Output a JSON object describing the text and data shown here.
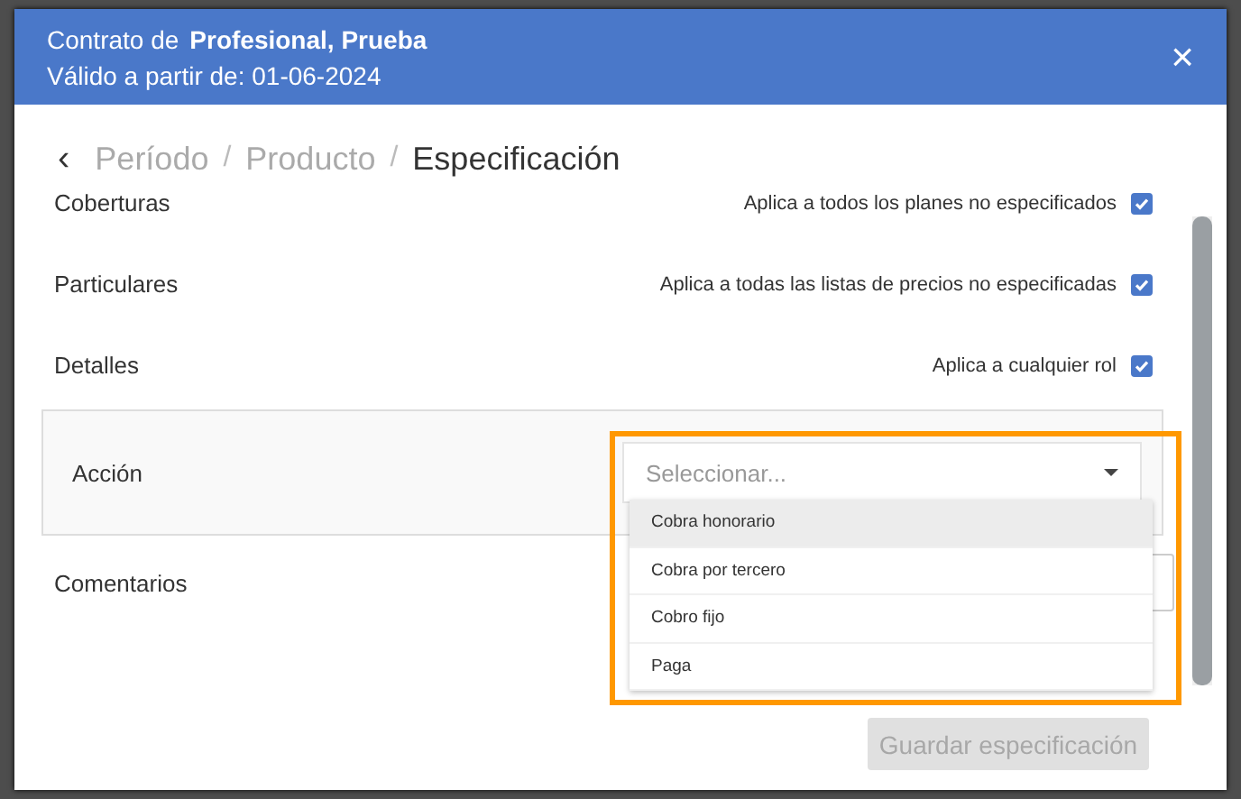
{
  "dialog": {
    "title_prefix": "Contrato de",
    "title_name": "Profesional, Prueba",
    "subtitle": "Válido a partir de: 01-06-2024",
    "close": "×"
  },
  "breadcrumb": {
    "back": "‹",
    "items": [
      {
        "label": "Período",
        "selected": false
      },
      {
        "label": "Producto",
        "selected": false
      },
      {
        "label": "Especificación",
        "selected": true
      }
    ],
    "separator": "/"
  },
  "rows": [
    {
      "label": "Coberturas",
      "option": "Aplica a todos los planes no especificados",
      "checked": true
    },
    {
      "label": "Particulares",
      "option": "Aplica a todas las listas de precios no especificadas",
      "checked": true
    },
    {
      "label": "Detalles",
      "option": "Aplica a cualquier rol",
      "checked": true
    }
  ],
  "action": {
    "label": "Acción",
    "placeholder": "Seleccionar...",
    "expanded": true,
    "options": [
      {
        "label": "Cobra honorario",
        "highlighted": true
      },
      {
        "label": "Cobra por tercero",
        "highlighted": false
      },
      {
        "label": "Cobro fijo",
        "highlighted": false
      },
      {
        "label": "Paga",
        "highlighted": false
      }
    ]
  },
  "comments": {
    "label": "Comentarios"
  },
  "save_button": {
    "label": "Guardar especificación",
    "disabled": true
  }
}
